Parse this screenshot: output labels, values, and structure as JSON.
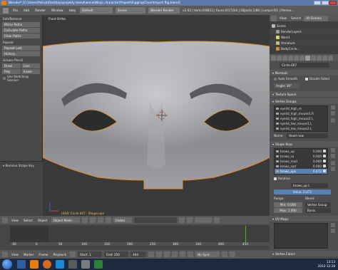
{
  "titlebar": {
    "title": "Blender* [C:\\Users\\Patryk\\Desktop\\projekty blend\\wanie\\Ninja character\\Projekt\\Rigging\\Clear\\Import Rig.blend]"
  },
  "menubar": {
    "items": [
      "File",
      "Add",
      "Render",
      "Window",
      "Help"
    ],
    "layout": "Default",
    "scene": "Scene",
    "engine": "Blender Render",
    "stats": "v2.63 | Verts:0/8823 | Faces:0/17244 | Objects:1/80 | Lamps:0/1 | Memor..."
  },
  "toolshelf": {
    "header": "Edit/Remove",
    "buttons": [
      "Mirror Paths",
      "Calculate Paths",
      "Clear Paths",
      "Repeat",
      "Repeat Last",
      "History...",
      "Grease Pencil"
    ],
    "grease_row1": [
      "Draw",
      "Line"
    ],
    "grease_row2": [
      "Poly",
      "Erase"
    ],
    "sketch_label": "Use Sketching Session",
    "redo_header": "Remove Shape Key"
  },
  "viewport": {
    "corner_label": "Front Ortho",
    "object_label": "(444) Circle.007 : Shape:ups"
  },
  "viewport_header": {
    "view": "View",
    "select": "Select",
    "object": "Object",
    "mode": "Object Mode",
    "pivot": "Global"
  },
  "timeline": {
    "ticks": [
      "-50",
      "0",
      "50",
      "100",
      "150",
      "200",
      "250",
      "300",
      "350",
      "400",
      "450"
    ],
    "view": "View",
    "marker": "Marker",
    "frame": "Frame",
    "playback": "Playback",
    "start": "Start: 1",
    "end": "End: 250",
    "current": "444",
    "sync": "No Sync"
  },
  "outliner": {
    "view": "View",
    "search": "Search",
    "filter": "All Scenes",
    "rows": [
      {
        "label": "Scene",
        "color": "#b8b8b8"
      },
      {
        "label": "RenderLayers",
        "color": "#9a9a9a"
      },
      {
        "label": "World",
        "color": "#d9d94a"
      },
      {
        "label": "Armature",
        "color": "#c9b88a"
      },
      {
        "label": "BodyCircle...",
        "color": "#e08a30"
      }
    ]
  },
  "properties": {
    "object_name": "Circle.007",
    "normals_header": "Normals",
    "auto_smooth": "Auto Smooth",
    "double_sided": "Double Sided",
    "angle": "Angle: 30°",
    "texture_space": "Texture Space",
    "vertex_groups": "Vertex Groups",
    "vg_list": [
      "eyelid_high_m",
      "eyelid_high_mouse1.R",
      "eyelid_high_mouse2.L",
      "eyelid_low_mouse1.L",
      "eyelid_low_mouse2.L"
    ],
    "name_label": "Name:",
    "name_value": "Head new",
    "shape_keys": "Shape Keys",
    "sk_list": [
      {
        "name": "brows_up",
        "value": "0.000"
      },
      {
        "name": "brows_sa",
        "value": "0.000"
      },
      {
        "name": "brows_mad",
        "value": "0.000"
      },
      {
        "name": "brows_sad",
        "value": "0.000"
      },
      {
        "name": "brows_ups",
        "value": "0.472"
      }
    ],
    "relative": "Relative",
    "sk_name": "brows_up L",
    "sk_value": "Value: 0.472",
    "range_label": "Range:",
    "blend_label": "Blend:",
    "min": "Min: 0.000",
    "max": "Max: 1.000",
    "vgroup_ph": "Vertex Group",
    "relative_to": "Basis",
    "uv_maps": "UV Maps",
    "vertex_colors": "Vertex Colors"
  },
  "clock": {
    "time": "13:13",
    "date": "2012-12-28"
  }
}
